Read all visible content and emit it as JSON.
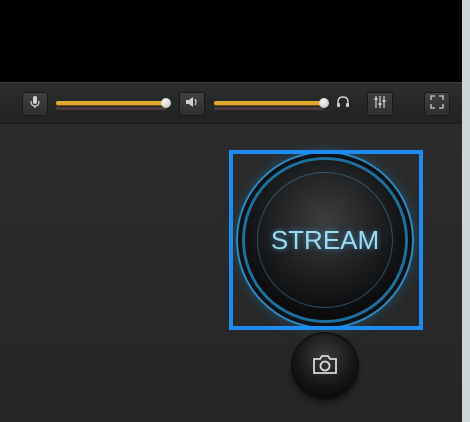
{
  "toolbar": {
    "mic_slider": {
      "icon": "microphone-icon",
      "value": 1.0,
      "fill_color": "#e3a92e"
    },
    "volume_slider": {
      "icon": "speaker-icon",
      "value": 1.0,
      "fill_color": "#e3a92e"
    },
    "headphones_icon": "headphones-icon",
    "mixer_icon": "equalizer-icon",
    "fullscreen_icon": "fullscreen-icon"
  },
  "main": {
    "stream_button": {
      "label": "STREAM",
      "accent": "#2b88c0"
    },
    "snapshot_button": {
      "icon": "camera-icon"
    }
  },
  "colors": {
    "highlight": "#1d8cf0",
    "preview_background": "#010101",
    "panel_background": "#282828"
  }
}
